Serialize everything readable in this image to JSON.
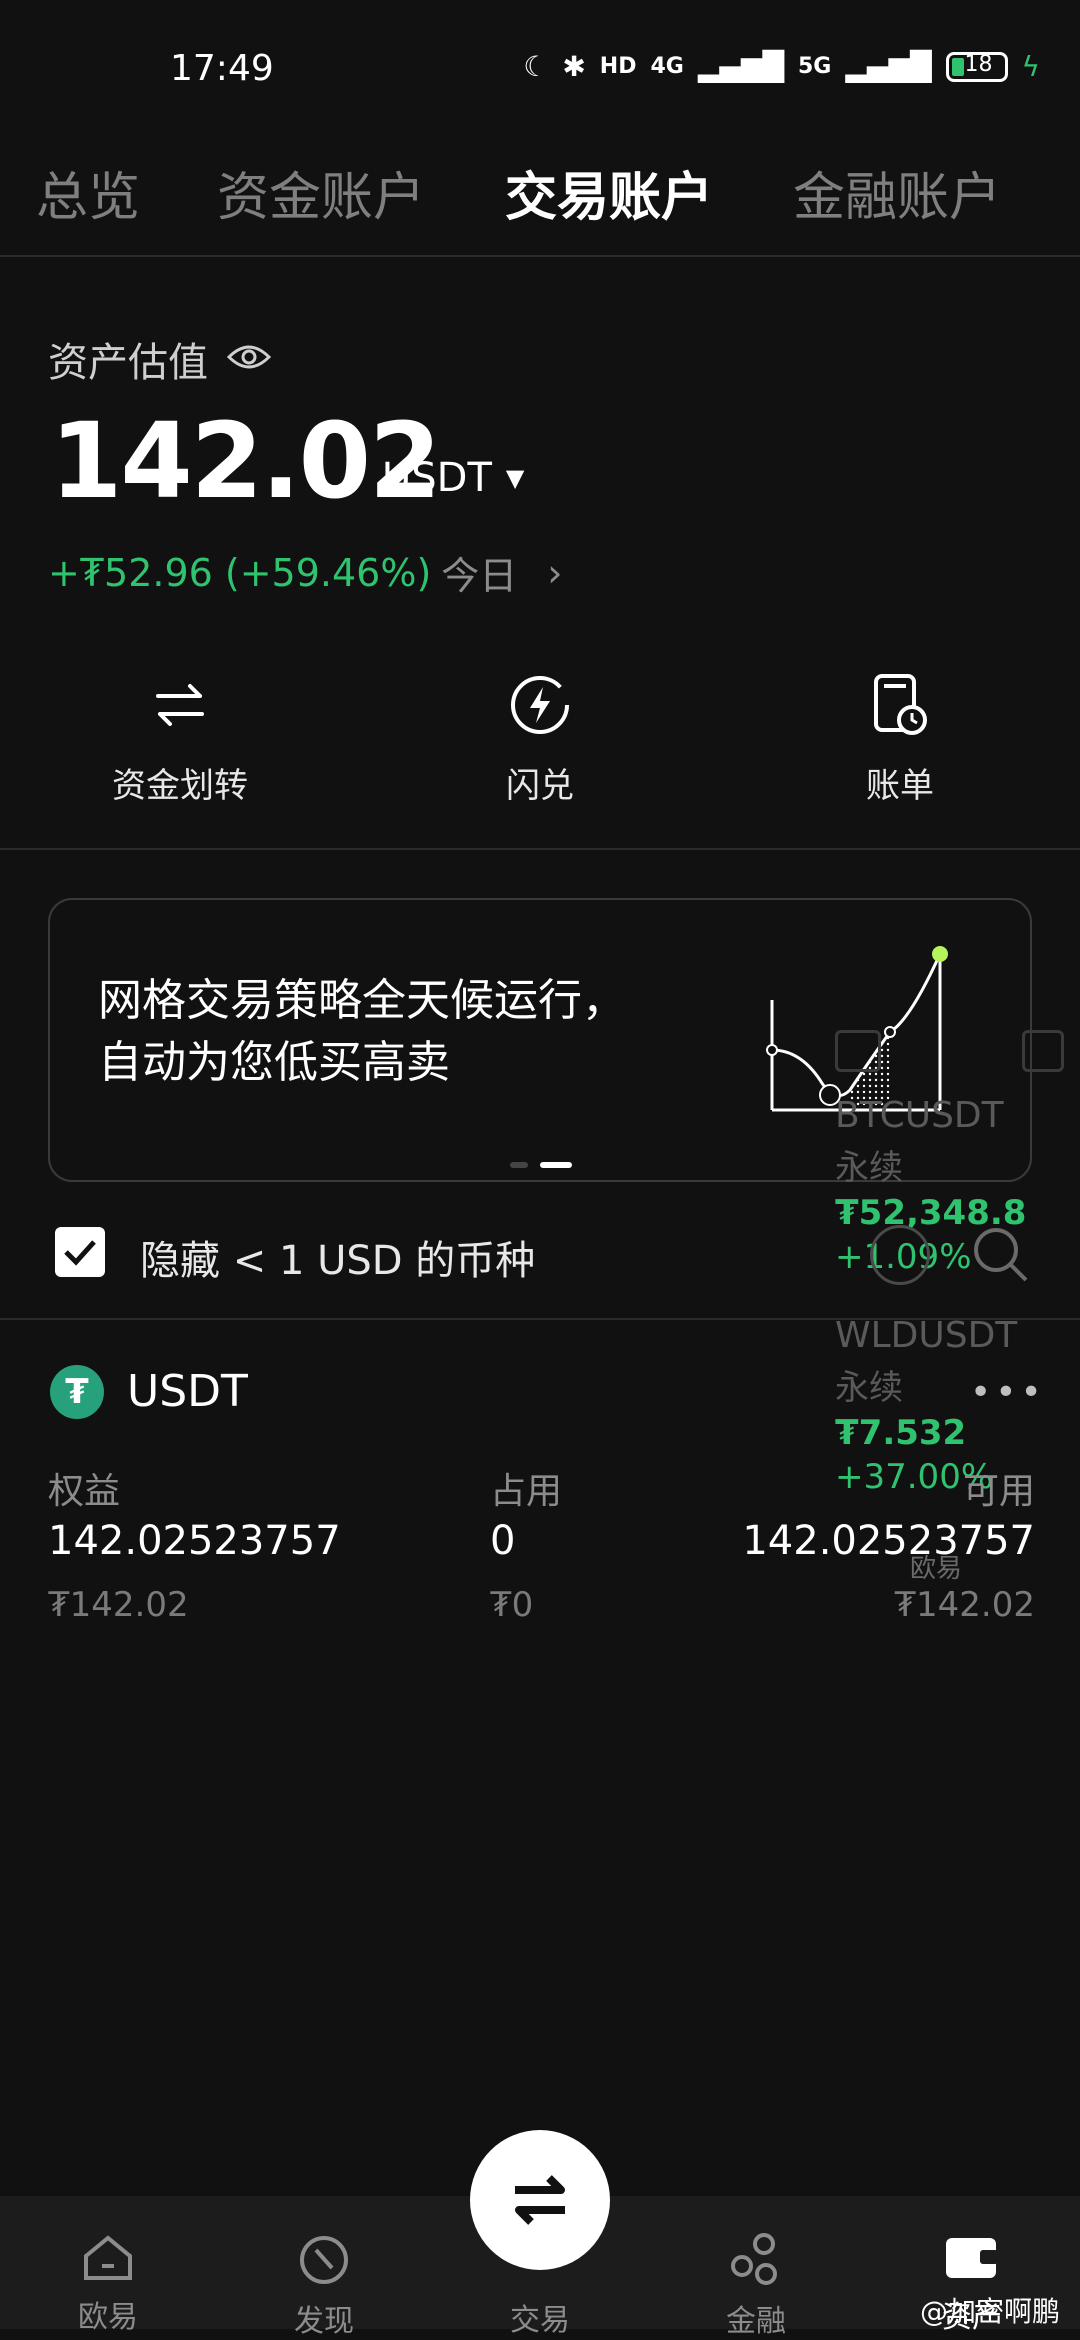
{
  "status_bar": {
    "time": "17:49",
    "signal1": "4G",
    "signal2": "5G",
    "battery": "18"
  },
  "tabs": [
    "总览",
    "资金账户",
    "交易账户",
    "金融账户"
  ],
  "asset": {
    "label": "资产估值",
    "amount": "142.02",
    "unit": "USDT",
    "pnl": "+₮52.96 (+59.46%)",
    "period": "今日"
  },
  "actions": [
    {
      "label": "资金划转",
      "icon": "transfer-icon"
    },
    {
      "label": "闪兑",
      "icon": "flash-swap-icon"
    },
    {
      "label": "账单",
      "icon": "bill-icon"
    }
  ],
  "banner": {
    "text": "网格交易策略全天候运行，\n自动为您低买高卖",
    "active_slide": 2,
    "slides": 2
  },
  "overlay_ticker": [
    {
      "symbol": "BTCUSDT",
      "type": "永续",
      "price": "₮52,348.8",
      "change": "+1.09%"
    },
    {
      "symbol": "WLDUSDT",
      "type": "永续",
      "price": "₮7.532",
      "change": "+37.00%"
    }
  ],
  "hide_small": {
    "label": "隐藏 < 1 USD 的币种",
    "checked": true
  },
  "currency": {
    "name": "USDT",
    "columns": [
      {
        "header": "权益",
        "value": "142.02523757",
        "sub": "₮142.02"
      },
      {
        "header": "占用",
        "value": "0",
        "sub": "₮0"
      },
      {
        "header": "可用",
        "value": "142.02523757",
        "sub": "₮142.02"
      }
    ]
  },
  "overlay_logo": "欧易",
  "bottom_nav": [
    {
      "label": "欧易",
      "icon": "home-icon"
    },
    {
      "label": "发现",
      "icon": "discover-icon"
    },
    {
      "label": "交易",
      "icon": "trade-swap-icon"
    },
    {
      "label": "金融",
      "icon": "finance-icon"
    },
    {
      "label": "资产",
      "icon": "wallet-icon"
    }
  ],
  "watermark": "@加密啊鹏",
  "colors": {
    "accent_green": "#2fc36f",
    "background": "#111111",
    "tether": "#26a17b"
  }
}
